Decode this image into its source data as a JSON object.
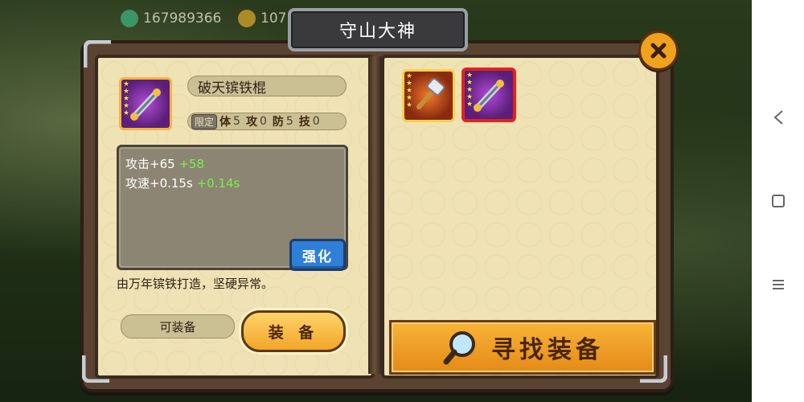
{
  "resources": {
    "jade": "167989366",
    "coins": "107"
  },
  "title": "守山大神",
  "item": {
    "name": "破天镔铁棍",
    "stars": [
      "★",
      "★",
      "★",
      "★",
      "★"
    ],
    "limited_tag": "限定",
    "stats": [
      {
        "key": "体",
        "value": "5"
      },
      {
        "key": "攻",
        "value": "0"
      },
      {
        "key": "防",
        "value": "5"
      },
      {
        "key": "技",
        "value": "0"
      }
    ],
    "attributes": [
      {
        "label": "攻击+65",
        "bonus": "+58"
      },
      {
        "label": "攻速+0.15s",
        "bonus": "+0.14s"
      }
    ],
    "description": "由万年镔铁打造，坚硬异常。",
    "equippable_label": "可装备"
  },
  "buttons": {
    "strengthen": "强化",
    "equip": "装 备",
    "find_equipment": "寻找装备"
  },
  "inventory": [
    {
      "name": "hammer",
      "stars": [
        "★",
        "★",
        "★",
        "★",
        "★"
      ],
      "selected": false
    },
    {
      "name": "破天镔铁棍",
      "stars": [
        "★",
        "★",
        "★",
        "★",
        "★"
      ],
      "selected": true
    }
  ],
  "colors": {
    "selected_border": "#e0231c",
    "accent_orange": "#f2a629",
    "bonus_green": "#7cf04a",
    "page_bg": "#efe2b5"
  }
}
